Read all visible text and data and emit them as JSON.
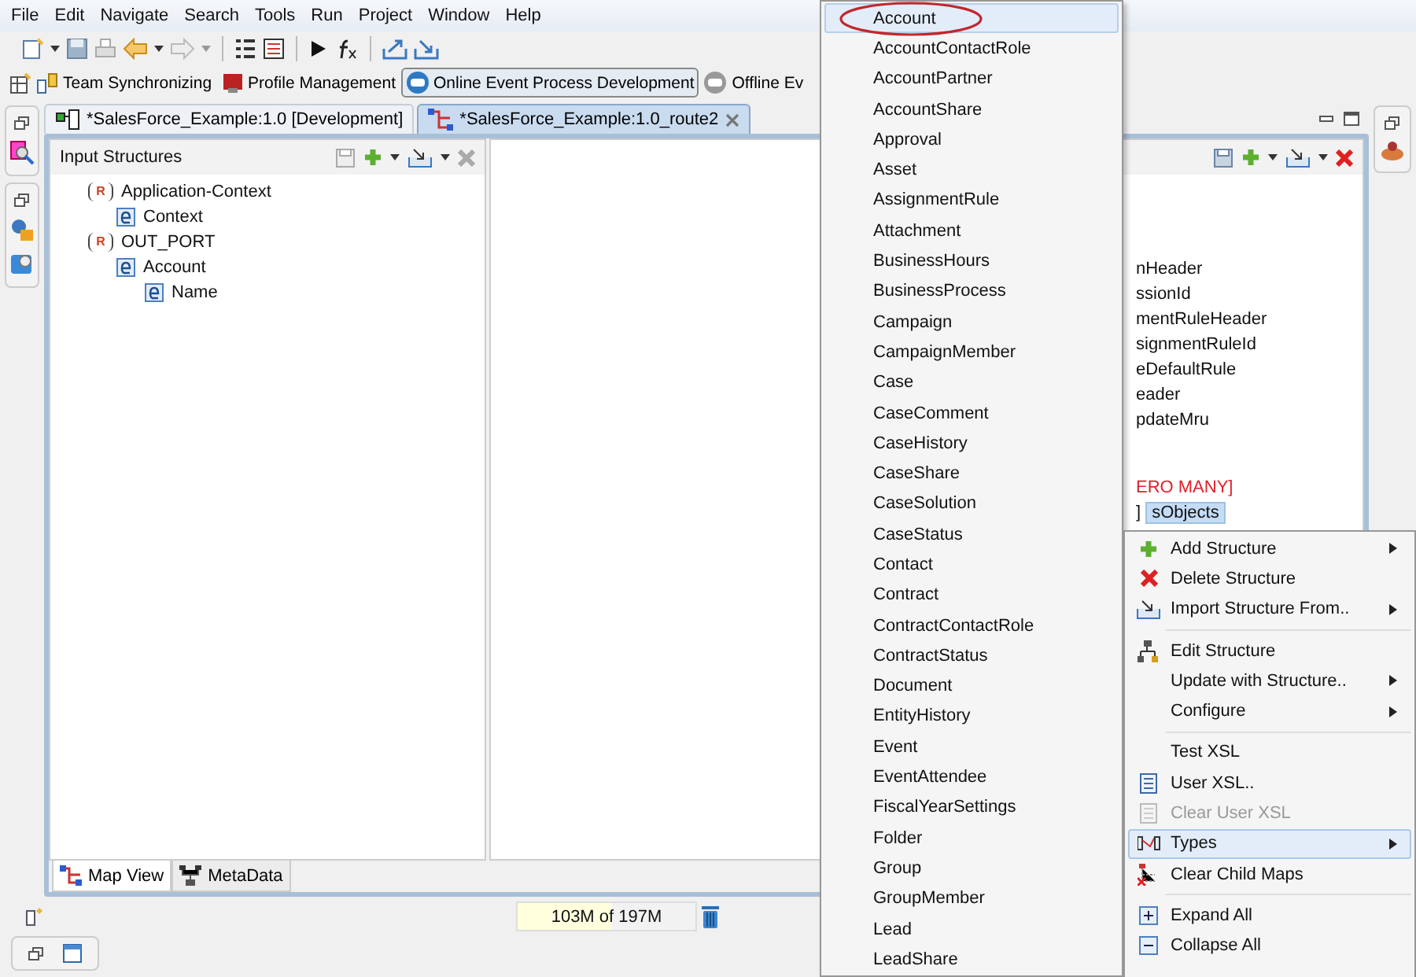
{
  "menu_bar": [
    "File",
    "Edit",
    "Navigate",
    "Search",
    "Tools",
    "Run",
    "Project",
    "Window",
    "Help"
  ],
  "perspectives": [
    {
      "label": "Team Synchronizing",
      "selected": false
    },
    {
      "label": "Profile Management",
      "selected": false
    },
    {
      "label": "Online Event Process Development",
      "selected": true
    },
    {
      "label": "Offline Ev",
      "selected": false
    }
  ],
  "editor_tabs": [
    {
      "label": "*SalesForce_Example:1.0 [Development]",
      "selected": false
    },
    {
      "label": "*SalesForce_Example:1.0_route2",
      "selected": true
    }
  ],
  "input_panel": {
    "title": "Input Structures",
    "tree": [
      {
        "label": "Application-Context",
        "kind": "record",
        "marker": "R",
        "children": [
          {
            "label": "Context",
            "kind": "element"
          }
        ]
      },
      {
        "label": "OUT_PORT",
        "kind": "record",
        "marker": "R",
        "children": [
          {
            "label": "Account",
            "kind": "element",
            "children": [
              {
                "label": "Name",
                "kind": "element"
              }
            ]
          }
        ]
      }
    ]
  },
  "output_panel": {
    "rows": [
      {
        "label": "nHeader",
        "kind": "field",
        "selected": false
      },
      {
        "label": "ssionId",
        "kind": "field",
        "selected": false
      },
      {
        "label": "mentRuleHeader",
        "kind": "field",
        "selected": false
      },
      {
        "label": "signmentRuleId",
        "kind": "field",
        "selected": false
      },
      {
        "label": "eDefaultRule",
        "kind": "field",
        "selected": false
      },
      {
        "label": "eader",
        "kind": "field",
        "selected": false
      },
      {
        "label": "pdateMru",
        "kind": "field",
        "selected": false
      },
      {
        "label": "ERO MANY]",
        "kind": "cardinality",
        "selected": false
      },
      {
        "prefix": "]",
        "label": "sObjects",
        "kind": "field",
        "selected": true
      }
    ]
  },
  "bottom_tabs": [
    {
      "label": "Map View",
      "selected": true
    },
    {
      "label": "MetaData",
      "selected": false
    }
  ],
  "memory": {
    "text": "103M of 197M",
    "level": 0.53
  },
  "types_menu": {
    "items": [
      {
        "label": "Account",
        "selected": true
      },
      {
        "label": "AccountContactRole",
        "selected": false
      },
      {
        "label": "AccountPartner",
        "selected": false
      },
      {
        "label": "AccountShare",
        "selected": false
      },
      {
        "label": "Approval",
        "selected": false
      },
      {
        "label": "Asset",
        "selected": false
      },
      {
        "label": "AssignmentRule",
        "selected": false
      },
      {
        "label": "Attachment",
        "selected": false
      },
      {
        "label": "BusinessHours",
        "selected": false
      },
      {
        "label": "BusinessProcess",
        "selected": false
      },
      {
        "label": "Campaign",
        "selected": false
      },
      {
        "label": "CampaignMember",
        "selected": false
      },
      {
        "label": "Case",
        "selected": false
      },
      {
        "label": "CaseComment",
        "selected": false
      },
      {
        "label": "CaseHistory",
        "selected": false
      },
      {
        "label": "CaseShare",
        "selected": false
      },
      {
        "label": "CaseSolution",
        "selected": false
      },
      {
        "label": "CaseStatus",
        "selected": false
      },
      {
        "label": "Contact",
        "selected": false
      },
      {
        "label": "Contract",
        "selected": false
      },
      {
        "label": "ContractContactRole",
        "selected": false
      },
      {
        "label": "ContractStatus",
        "selected": false
      },
      {
        "label": "Document",
        "selected": false
      },
      {
        "label": "EntityHistory",
        "selected": false
      },
      {
        "label": "Event",
        "selected": false
      },
      {
        "label": "EventAttendee",
        "selected": false
      },
      {
        "label": "FiscalYearSettings",
        "selected": false
      },
      {
        "label": "Folder",
        "selected": false
      },
      {
        "label": "Group",
        "selected": false
      },
      {
        "label": "GroupMember",
        "selected": false
      },
      {
        "label": "Lead",
        "selected": false
      },
      {
        "label": "LeadShare",
        "selected": false
      }
    ]
  },
  "context_menu": {
    "groups": [
      {
        "items": [
          {
            "label": "Add Structure",
            "submenu": true,
            "disabled": false,
            "selected": false
          },
          {
            "label": "Delete Structure",
            "submenu": false,
            "disabled": false,
            "selected": false
          },
          {
            "label": "Import Structure From..",
            "submenu": true,
            "disabled": false,
            "selected": false
          }
        ]
      },
      {
        "items": [
          {
            "label": "Edit Structure",
            "submenu": false,
            "disabled": false,
            "selected": false
          },
          {
            "label": "Update with Structure..",
            "submenu": true,
            "disabled": false,
            "selected": false
          },
          {
            "label": "Configure",
            "submenu": true,
            "disabled": false,
            "selected": false
          }
        ]
      },
      {
        "items": [
          {
            "label": "Test XSL",
            "submenu": false,
            "disabled": false,
            "selected": false
          },
          {
            "label": "User XSL..",
            "submenu": false,
            "disabled": false,
            "selected": false
          },
          {
            "label": "Clear User XSL",
            "submenu": false,
            "disabled": true,
            "selected": false
          },
          {
            "label": "Types",
            "submenu": true,
            "disabled": false,
            "selected": true
          },
          {
            "label": "Clear Child Maps",
            "submenu": false,
            "disabled": false,
            "selected": false
          }
        ]
      },
      {
        "items": [
          {
            "label": "Expand All",
            "submenu": false,
            "disabled": false,
            "selected": false
          },
          {
            "label": "Collapse All",
            "submenu": false,
            "disabled": false,
            "selected": false
          }
        ]
      }
    ]
  }
}
